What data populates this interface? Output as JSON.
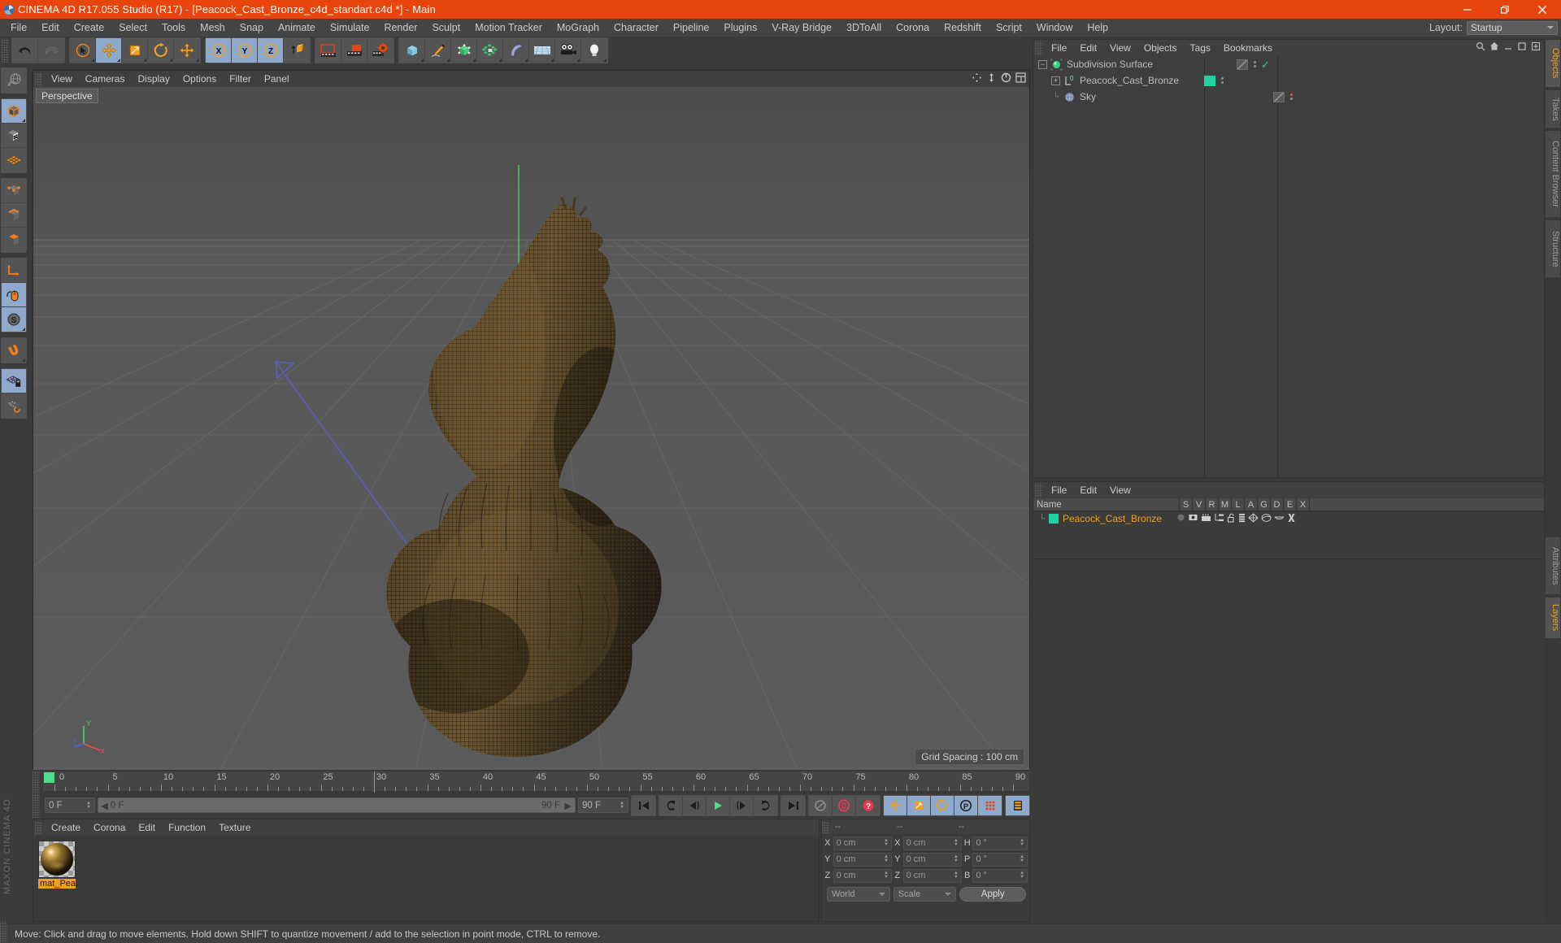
{
  "window": {
    "title": "CINEMA 4D R17.055 Studio (R17) - [Peacock_Cast_Bronze_c4d_standart.c4d *] - Main",
    "logo_icon": "c4d-logo-icon",
    "minimize_icon": "minimize-icon",
    "restore_icon": "restore-icon",
    "close_icon": "close-icon",
    "accent_color": "#e8450c"
  },
  "menubar": {
    "items": [
      "File",
      "Edit",
      "Create",
      "Select",
      "Tools",
      "Mesh",
      "Snap",
      "Animate",
      "Simulate",
      "Render",
      "Sculpt",
      "Motion Tracker",
      "MoGraph",
      "Character",
      "Pipeline",
      "Plugins",
      "V-Ray Bridge",
      "3DToAll",
      "Corona",
      "Redshift",
      "Script",
      "Window",
      "Help"
    ],
    "layout_label": "Layout:",
    "layout_value": "Startup",
    "search_icon": "search-icon",
    "home-icon": "home-icon"
  },
  "toolbar": {
    "groups": [
      {
        "name": "undo-redo",
        "buttons": [
          {
            "name": "undo-button",
            "icon": "undo-arrow-icon",
            "active": false
          },
          {
            "name": "redo-button",
            "icon": "redo-arrow-icon",
            "active": false
          }
        ]
      },
      {
        "name": "transform-tools",
        "buttons": [
          {
            "name": "live-selection-tool",
            "icon": "cursor-circle-icon",
            "active": false
          },
          {
            "name": "move-tool",
            "icon": "move-cross-icon",
            "active": true
          },
          {
            "name": "scale-tool",
            "icon": "scale-box-icon",
            "active": false
          },
          {
            "name": "rotate-tool",
            "icon": "rotate-circle-icon",
            "active": false
          },
          {
            "name": "global-move-tool",
            "icon": "move-cross-icon",
            "active": false
          }
        ]
      },
      {
        "name": "axis-locks",
        "buttons": [
          {
            "name": "lock-x-axis-button",
            "icon": "x-axis-icon",
            "active": true
          },
          {
            "name": "lock-y-axis-button",
            "icon": "y-axis-icon",
            "active": true
          },
          {
            "name": "lock-z-axis-button",
            "icon": "z-axis-icon",
            "active": true
          },
          {
            "name": "world-object-coordinates-button",
            "icon": "world-axis-cube-icon",
            "active": false
          }
        ]
      },
      {
        "name": "render-tools",
        "buttons": [
          {
            "name": "render-view-button",
            "icon": "clapperboard-icon",
            "active": false
          },
          {
            "name": "render-to-picture-viewer-button",
            "icon": "clapperboard-picture-icon",
            "active": false
          },
          {
            "name": "render-settings-button",
            "icon": "clapperboard-gear-icon",
            "active": false
          }
        ]
      },
      {
        "name": "create-objects",
        "buttons": [
          {
            "name": "add-cube-button",
            "icon": "cube-icon",
            "active": false
          },
          {
            "name": "add-spline-button",
            "icon": "pen-icon",
            "active": false
          },
          {
            "name": "add-generator-button",
            "icon": "generator-cube-icon",
            "active": false
          },
          {
            "name": "add-array-button",
            "icon": "array-icon",
            "active": false
          },
          {
            "name": "add-deformer-button",
            "icon": "bend-deformer-icon",
            "active": false
          },
          {
            "name": "add-environment-button",
            "icon": "floor-grid-icon",
            "active": false
          },
          {
            "name": "add-camera-button",
            "icon": "camera-icon",
            "active": false
          },
          {
            "name": "add-light-button",
            "icon": "light-bulb-icon",
            "active": false
          }
        ]
      }
    ]
  },
  "left_palette": {
    "groups": [
      {
        "name": "undo-view-group",
        "buttons": [
          {
            "name": "undo-view-button",
            "icon": "globe-undo-icon",
            "active": false
          }
        ]
      },
      {
        "name": "selection-mode-group",
        "buttons": [
          {
            "name": "model-mode-button",
            "icon": "model-cube-icon",
            "active": true
          },
          {
            "name": "texture-mode-button",
            "icon": "texture-checker-cube-icon",
            "active": false
          },
          {
            "name": "workplane-mode-button",
            "icon": "workplane-grid-icon",
            "active": false
          }
        ]
      },
      {
        "name": "component-mode-group",
        "buttons": [
          {
            "name": "point-mode-button",
            "icon": "point-cube-icon",
            "active": false
          },
          {
            "name": "edge-mode-button",
            "icon": "edge-cube-icon",
            "active": false
          },
          {
            "name": "polygon-mode-button",
            "icon": "polygon-cube-icon",
            "active": false
          }
        ]
      },
      {
        "name": "axis-group",
        "buttons": [
          {
            "name": "enable-axis-button",
            "icon": "axis-corner-icon",
            "active": false
          },
          {
            "name": "viewport-solo-button",
            "icon": "mouse-icon",
            "active": true
          },
          {
            "name": "enable-snap-button",
            "icon": "snap-s-icon",
            "active": true
          }
        ]
      },
      {
        "name": "magnet-group",
        "buttons": [
          {
            "name": "magnet-tool-button",
            "icon": "magnet-icon",
            "active": false
          }
        ]
      },
      {
        "name": "workplane-group",
        "buttons": [
          {
            "name": "lock-workplane-button",
            "icon": "workplane-lock-icon",
            "active": true
          },
          {
            "name": "planar-workplane-button",
            "icon": "workplane-rotate-icon",
            "active": false
          }
        ]
      }
    ],
    "brand": "MAXON CINEMA 4D"
  },
  "viewport": {
    "menu_items": [
      "View",
      "Cameras",
      "Display",
      "Options",
      "Filter",
      "Panel"
    ],
    "label": "Perspective",
    "grid_spacing": "Grid Spacing : 100 cm",
    "corner_icons": [
      "move-view-icon",
      "pan-view-icon",
      "rotate-view-icon",
      "maximize-view-icon"
    ],
    "axis_labels": {
      "x": "X",
      "y": "Y",
      "z": "Z"
    },
    "object_name": "Peacock_Cast_Bronze",
    "background_color": "#565656",
    "grid_color": "#6c6c6c"
  },
  "timeline": {
    "ticks": [
      0,
      5,
      10,
      15,
      20,
      25,
      30,
      35,
      40,
      45,
      50,
      55,
      60,
      65,
      70,
      75,
      80,
      85,
      90
    ],
    "min_frame": 0,
    "max_frame": 90,
    "current_frame": 0,
    "marker_color": "#4ede8a"
  },
  "transport": {
    "current_frame_field": "0 F",
    "scrub_left_label": "0 F",
    "scrub_right_label": "90 F",
    "end_frame_field": "90 F",
    "preview_end_field": "0 F",
    "buttons": [
      {
        "name": "go-to-start-button",
        "icon": "skip-start-icon",
        "active": false
      },
      {
        "name": "play-reverse-button",
        "icon": "play-reverse-icon",
        "active": false
      },
      {
        "name": "previous-frame-button",
        "icon": "previous-frame-icon",
        "active": false
      },
      {
        "name": "play-button",
        "icon": "play-icon",
        "active": false
      },
      {
        "name": "next-frame-button",
        "icon": "next-frame-icon",
        "active": false
      },
      {
        "name": "play-forward-button",
        "icon": "loop-icon",
        "active": false
      },
      {
        "name": "go-to-end-button",
        "icon": "skip-end-icon",
        "active": false
      },
      {
        "name": "record-active-objects-button",
        "icon": "record-disabled-icon",
        "active": false
      },
      {
        "name": "autokeying-button",
        "icon": "autokey-icon",
        "active": false
      },
      {
        "name": "keyframe-selection-button",
        "icon": "keyframe-question-icon",
        "active": false
      },
      {
        "name": "position-key-button",
        "icon": "move-cross-icon",
        "active": true
      },
      {
        "name": "scale-key-button",
        "icon": "scale-box-icon",
        "active": true
      },
      {
        "name": "rotation-key-button",
        "icon": "rotate-circle-icon",
        "active": true
      },
      {
        "name": "parameter-key-button",
        "icon": "parameter-p-icon",
        "active": true
      },
      {
        "name": "point-level-animation-button",
        "icon": "pla-dots-icon",
        "active": true
      },
      {
        "name": "animation-layers-button",
        "icon": "animation-layers-icon",
        "active": true
      }
    ]
  },
  "material_manager": {
    "menu_items": [
      "Create",
      "Corona",
      "Edit",
      "Function",
      "Texture"
    ],
    "materials": [
      {
        "name": "mat_Pea",
        "selected": true,
        "preview": "bronze-sphere-preview"
      }
    ]
  },
  "coordinates": {
    "headers": [
      "--",
      "--",
      "--"
    ],
    "rows": [
      {
        "label1": "X",
        "value1": "0 cm",
        "label2": "X",
        "value2": "0 cm",
        "label3": "H",
        "value3": "0 °"
      },
      {
        "label1": "Y",
        "value1": "0 cm",
        "label2": "Y",
        "value2": "0 cm",
        "label3": "P",
        "value3": "0 °"
      },
      {
        "label1": "Z",
        "value1": "0 cm",
        "label2": "Z",
        "value2": "0 cm",
        "label3": "B",
        "value3": "0 °"
      }
    ],
    "coord_system": "World",
    "size_mode": "Scale",
    "apply_label": "Apply"
  },
  "object_manager": {
    "menu_items": [
      "File",
      "Edit",
      "View",
      "Objects",
      "Tags",
      "Bookmarks"
    ],
    "rows": [
      {
        "name": "Subdivision Surface",
        "depth": 0,
        "icon": "subdivision-surface-icon",
        "expander": "-",
        "tag_color": "none",
        "dot": "check"
      },
      {
        "name": "Peacock_Cast_Bronze",
        "depth": 1,
        "icon": "polygon-object-icon",
        "expander": "+",
        "tag_color": "#1fd1a0",
        "dot": "none"
      },
      {
        "name": "Sky",
        "depth": 1,
        "icon": "sky-object-icon",
        "expander": "none",
        "tag_color": "none",
        "dot": "red"
      }
    ]
  },
  "layer_manager": {
    "menu_items": [
      "File",
      "Edit",
      "View"
    ],
    "columns": [
      "Name",
      "S",
      "V",
      "R",
      "M",
      "L",
      "A",
      "G",
      "D",
      "E",
      "X"
    ],
    "rows": [
      {
        "name": "Peacock_Cast_Bronze",
        "color": "#1fd1a0"
      }
    ]
  },
  "right_tabs": {
    "top": [
      {
        "label": "Objects",
        "active": true
      },
      {
        "label": "Takes",
        "active": false
      },
      {
        "label": "Content Browser",
        "active": false
      },
      {
        "label": "Structure",
        "active": false
      }
    ],
    "bottom": [
      {
        "label": "Attributes",
        "active": false
      },
      {
        "label": "Layers",
        "active": true
      }
    ]
  },
  "statusbar": {
    "message": "Move: Click and drag to move elements. Hold down SHIFT to quantize movement / add to the selection in point mode, CTRL to remove."
  }
}
